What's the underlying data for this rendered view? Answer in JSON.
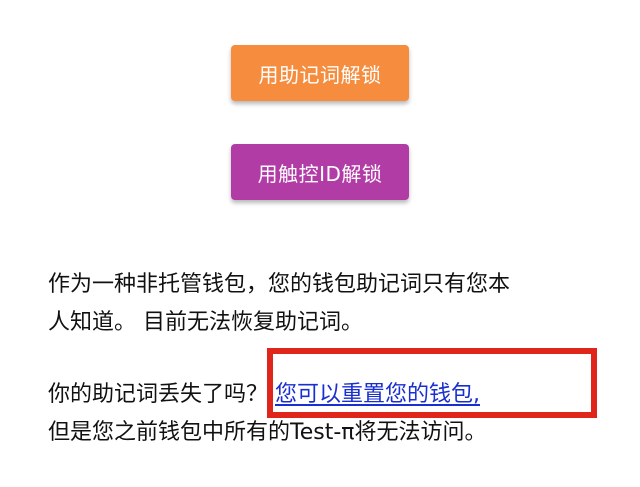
{
  "buttons": {
    "mnemonic_unlock_label": "用助记词解锁",
    "touchid_unlock_label": "用触控ID解锁"
  },
  "info": {
    "paragraph1_line1": "作为一种非托管钱包，您的钱包助记词只有您本",
    "paragraph1_line2": "人知道。 目前无法恢复助记词。",
    "paragraph2_prefix": "你的助记词丢失了吗？ ",
    "reset_link_label": "您可以重置您的钱包,",
    "paragraph2_line2": "但是您之前钱包中所有的Test-π将无法访问。"
  },
  "colors": {
    "mnemonic_button": "#f68d3e",
    "touchid_button": "#b23ca6",
    "link": "#1a2fcf",
    "highlight_box": "#e0251b"
  }
}
